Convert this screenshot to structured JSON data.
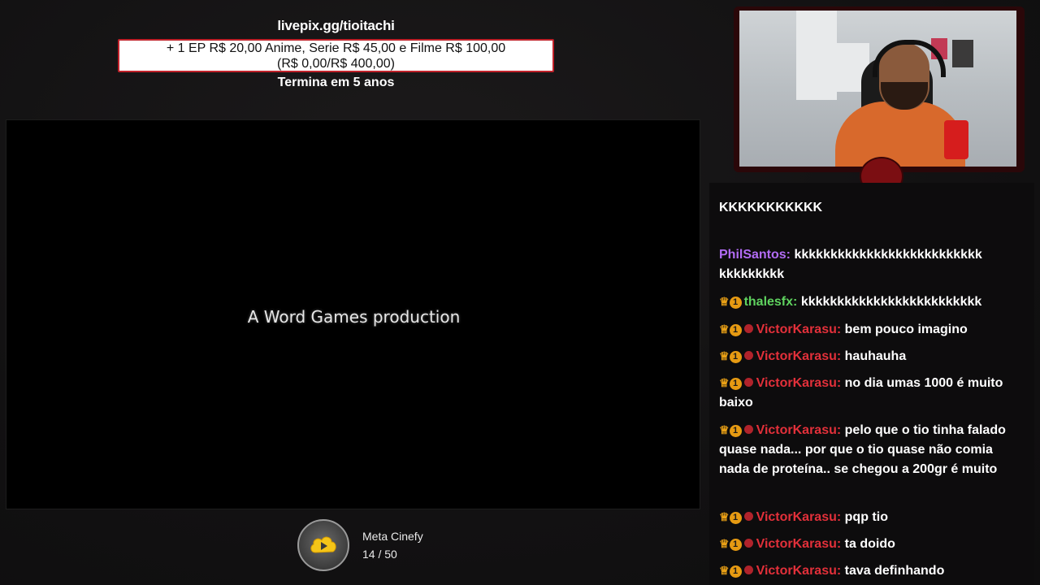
{
  "donation": {
    "url": "livepix.gg/tioitachi",
    "goal_line1": "+ 1 EP R$ 20,00 Anime, Serie R$ 45,00 e Filme R$ 100,00",
    "goal_line2": "(R$ 0,00/R$ 400,00)",
    "ends": "Termina em 5 anos"
  },
  "video": {
    "caption": "A Word Games production"
  },
  "goal_widget": {
    "icon": "cinefy-play-icon",
    "title": "Meta Cinefy",
    "progress_text": "14 / 50",
    "current": 14,
    "target": 50
  },
  "colors": {
    "accent_red": "#c0222a",
    "phil_color": "#b26cf5",
    "thales_color": "#5fd35f",
    "victor_color": "#e2303a",
    "badge_gold": "#f0a516"
  },
  "chat": {
    "messages": [
      {
        "user": "",
        "text": "KKKKKKKKKKK"
      },
      {
        "user": "PhilSantos:",
        "text": "kkkkkkkkkkkkkkkkkkkkkkkkkk kkkkkkkkk"
      },
      {
        "user": "thalesfx:",
        "text": "kkkkkkkkkkkkkkkkkkkkkkkkk"
      },
      {
        "user": "VictorKarasu:",
        "text": "bem pouco imagino"
      },
      {
        "user": "VictorKarasu:",
        "text": "hauhauha"
      },
      {
        "user": "VictorKarasu:",
        "text": "no dia umas 1000 é muito baixo"
      },
      {
        "user": "VictorKarasu:",
        "text": "pelo que o tio tinha falado quase nada... por que o tio quase não comia nada de proteína.. se chegou a 200gr é muito"
      },
      {
        "user": "VictorKarasu:",
        "text": "pqp tio"
      },
      {
        "user": "VictorKarasu:",
        "text": "ta doido"
      },
      {
        "user": "VictorKarasu:",
        "text": "tava definhando"
      }
    ]
  }
}
